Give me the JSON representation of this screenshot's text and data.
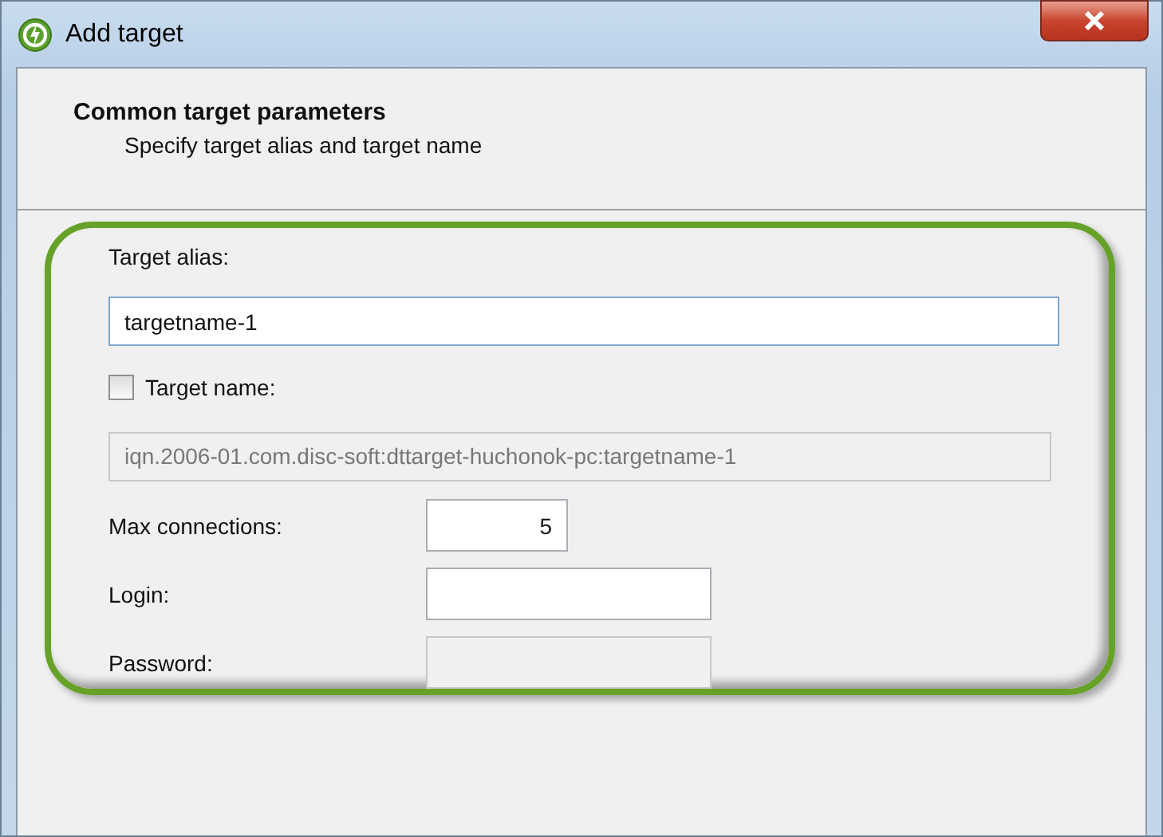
{
  "window": {
    "title": "Add target"
  },
  "header": {
    "title": "Common target parameters",
    "subtitle": "Specify target alias and target name"
  },
  "form": {
    "alias": {
      "label": "Target alias:",
      "value": "targetname-1"
    },
    "target_name": {
      "label": "Target name:",
      "checked": false,
      "value": "iqn.2006-01.com.disc-soft:dttarget-huchonok-pc:targetname-1",
      "disabled": true
    },
    "fields": [
      {
        "label": "Max connections:",
        "value": "5",
        "kind": "number",
        "disabled": false
      },
      {
        "label": "Login:",
        "kind": "text",
        "disabled": false
      },
      {
        "label": "Password:",
        "kind": "text",
        "disabled": true
      }
    ]
  }
}
